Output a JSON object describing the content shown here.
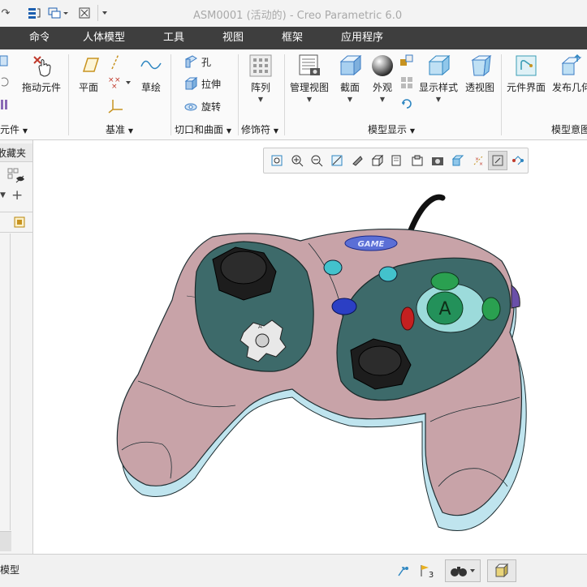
{
  "window": {
    "title": "ASM0001 (活动的) - Creo Parametric 6.0"
  },
  "quick_access": {
    "icons": [
      "redo-icon",
      "regenerate-icon",
      "windows-icon",
      "close-window-icon",
      "customize-icon"
    ]
  },
  "tabs": [
    "命令",
    "人体模型",
    "工具",
    "视图",
    "框架",
    "应用程序"
  ],
  "ribbon": {
    "buttons": {
      "drag_component": "拖动元件",
      "plane": "平面",
      "sketch": "草绘",
      "hole": "孔",
      "extrude": "拉伸",
      "revolve": "旋转",
      "pattern": "阵列",
      "manage_views": "管理视图",
      "section": "截面",
      "appearance": "外观",
      "display_style": "显示样式",
      "perspective": "透视图",
      "component_interface": "元件界面",
      "publish_geometry": "发布几何"
    },
    "groups": {
      "component": "元件",
      "datum": "基准",
      "cut_surface": "切口和曲面",
      "modifiers": "修饰符",
      "model_display": "模型显示",
      "model_intent": "模型意图"
    }
  },
  "left_panel": {
    "tab_label": "收藏夹"
  },
  "status": {
    "left_text": "模型",
    "flag_count": "3"
  },
  "model": {
    "logo_text": "GAME",
    "a_button": "A"
  },
  "colors": {
    "ribbon_tab_bg": "#3e3e3e",
    "controller_body": "#c8a3a8",
    "controller_underside": "#bfe4ee",
    "face_plate": "#3d6a6a",
    "cyan_buttons": "#43c2cc",
    "blue_button": "#2b3fc4",
    "green_buttons": "#2aa050",
    "red_button": "#c42020",
    "cable": "#111111"
  }
}
